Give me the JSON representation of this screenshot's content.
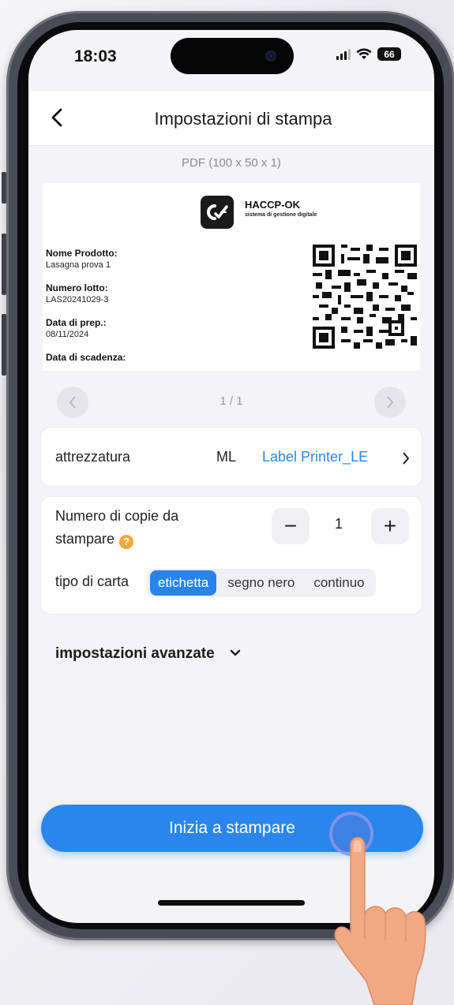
{
  "status_bar": {
    "time": "18:03",
    "battery": "66"
  },
  "nav": {
    "title": "Impostazioni di stampa"
  },
  "preview": {
    "subtitle": "PDF  (100 x 50 x 1)",
    "brand": "HACCP-OK",
    "brand_tagline": "sistema di gestione digitale",
    "fields": [
      {
        "label": "Nome Prodotto:",
        "value": "Lasagna prova 1"
      },
      {
        "label": "Numero lotto:",
        "value": "LAS20241029-3"
      },
      {
        "label": "Data di prep.:",
        "value": "08/11/2024"
      },
      {
        "label": "Data di scadenza:",
        "value": ""
      }
    ]
  },
  "pager": {
    "text": "1 / 1"
  },
  "device": {
    "label": "attrezzatura",
    "model": "ML",
    "printer": "Label Printer_LE"
  },
  "copies": {
    "label_line1": "Numero di copie da",
    "label_line2": "stampare",
    "value": "1",
    "minus": "−",
    "plus": "+"
  },
  "paper": {
    "label": "tipo di carta",
    "options": [
      "etichetta",
      "segno nero",
      "continuo"
    ],
    "selected": "etichetta"
  },
  "advanced": {
    "label": "impostazioni avanzate"
  },
  "actions": {
    "print": "Inizia a stampare"
  },
  "colors": {
    "accent": "#2a86ea",
    "help": "#f3a935"
  }
}
